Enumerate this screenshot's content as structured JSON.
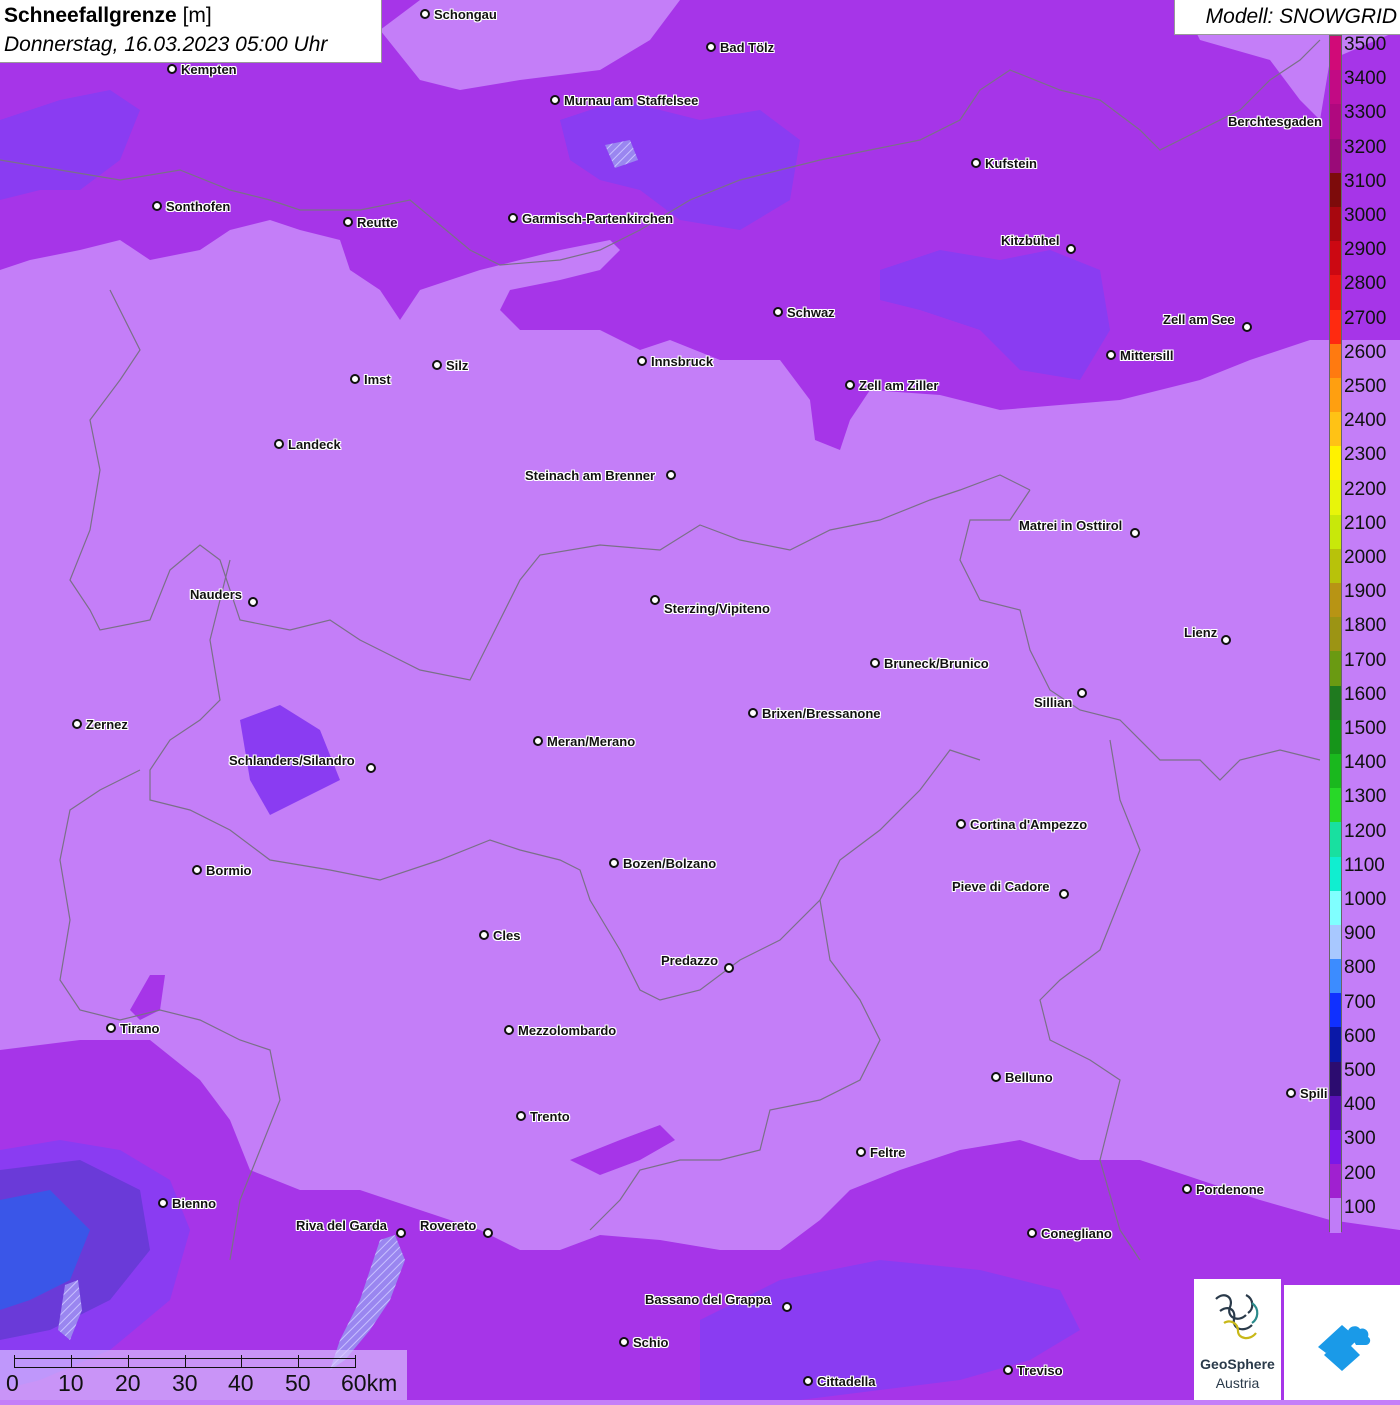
{
  "header": {
    "title_bold": "Schneefallgrenze",
    "title_unit": " [m]",
    "datetime": "Donnerstag, 16.03.2023 05:00 Uhr",
    "model": "Modell: SNOWGRID"
  },
  "legend": {
    "labels": [
      "3500",
      "3400",
      "3300",
      "3200",
      "3100",
      "3000",
      "2900",
      "2800",
      "2700",
      "2600",
      "2500",
      "2400",
      "2300",
      "2200",
      "2100",
      "2000",
      "1900",
      "1800",
      "1700",
      "1600",
      "1500",
      "1400",
      "1300",
      "1200",
      "1100",
      "1000",
      "900",
      "800",
      "700",
      "600",
      "500",
      "400",
      "300",
      "200",
      "100"
    ],
    "colors": [
      "#d10a78",
      "#c20a84",
      "#b0087f",
      "#9a0a78",
      "#7d0b0b",
      "#a8070f",
      "#cc0812",
      "#e81414",
      "#ff2a10",
      "#ff7a10",
      "#ff9f10",
      "#ffc215",
      "#fff200",
      "#e8f50a",
      "#c8e80a",
      "#b8c20a",
      "#b89414",
      "#9c9414",
      "#6a9a12",
      "#1f7a1f",
      "#16951a",
      "#1ab81e",
      "#28d828",
      "#18e0a0",
      "#10eed0",
      "#80ffff",
      "#a8c8ff",
      "#3c8cff",
      "#1030ff",
      "#0a18a8",
      "#2c0c70",
      "#5a10b8",
      "#7a18e8",
      "#a020d0",
      "#c07cf8"
    ]
  },
  "cities": [
    {
      "name": "Schongau"
    },
    {
      "name": "Bad Tölz"
    },
    {
      "name": "Kempten"
    },
    {
      "name": "Murnau am Staffelsee"
    },
    {
      "name": "Berchtesgaden"
    },
    {
      "name": "Kufstein"
    },
    {
      "name": "Sonthofen"
    },
    {
      "name": "Reutte"
    },
    {
      "name": "Garmisch-Partenkirchen"
    },
    {
      "name": "Kitzbühel"
    },
    {
      "name": "Schwaz"
    },
    {
      "name": "Zell am See"
    },
    {
      "name": "Innsbruck"
    },
    {
      "name": "Silz"
    },
    {
      "name": "Mittersill"
    },
    {
      "name": "Imst"
    },
    {
      "name": "Zell am Ziller"
    },
    {
      "name": "Landeck"
    },
    {
      "name": "Steinach am Brenner"
    },
    {
      "name": "Matrei in Osttirol"
    },
    {
      "name": "Nauders"
    },
    {
      "name": "Sterzing/Vipiteno"
    },
    {
      "name": "Lienz"
    },
    {
      "name": "Bruneck/Brunico"
    },
    {
      "name": "Sillian"
    },
    {
      "name": "Zernez"
    },
    {
      "name": "Brixen/Bressanone"
    },
    {
      "name": "Meran/Merano"
    },
    {
      "name": "Schlanders/Silandro"
    },
    {
      "name": "Cortina d'Ampezzo"
    },
    {
      "name": "Bozen/Bolzano"
    },
    {
      "name": "Bormio"
    },
    {
      "name": "Pieve di Cadore"
    },
    {
      "name": "Cles"
    },
    {
      "name": "Predazzo"
    },
    {
      "name": "Tirano"
    },
    {
      "name": "Mezzolombardo"
    },
    {
      "name": "Belluno"
    },
    {
      "name": "Spili"
    },
    {
      "name": "Trento"
    },
    {
      "name": "Feltre"
    },
    {
      "name": "Pordenone"
    },
    {
      "name": "Bienno"
    },
    {
      "name": "Riva del Garda"
    },
    {
      "name": "Rovereto"
    },
    {
      "name": "Conegliano"
    },
    {
      "name": "Bassano del Grappa"
    },
    {
      "name": "Schio"
    },
    {
      "name": "Treviso"
    },
    {
      "name": "Cittadella"
    }
  ],
  "scale": {
    "labels": [
      "0",
      "10",
      "20",
      "30",
      "40",
      "50",
      "60km"
    ]
  },
  "logo": {
    "name_line1": "GeoSphere",
    "name_line2": "Austria"
  },
  "colors": {
    "base_purple": "#c47ef8",
    "medium_purple": "#a635e8",
    "dark_violet": "#8a3cf2"
  }
}
